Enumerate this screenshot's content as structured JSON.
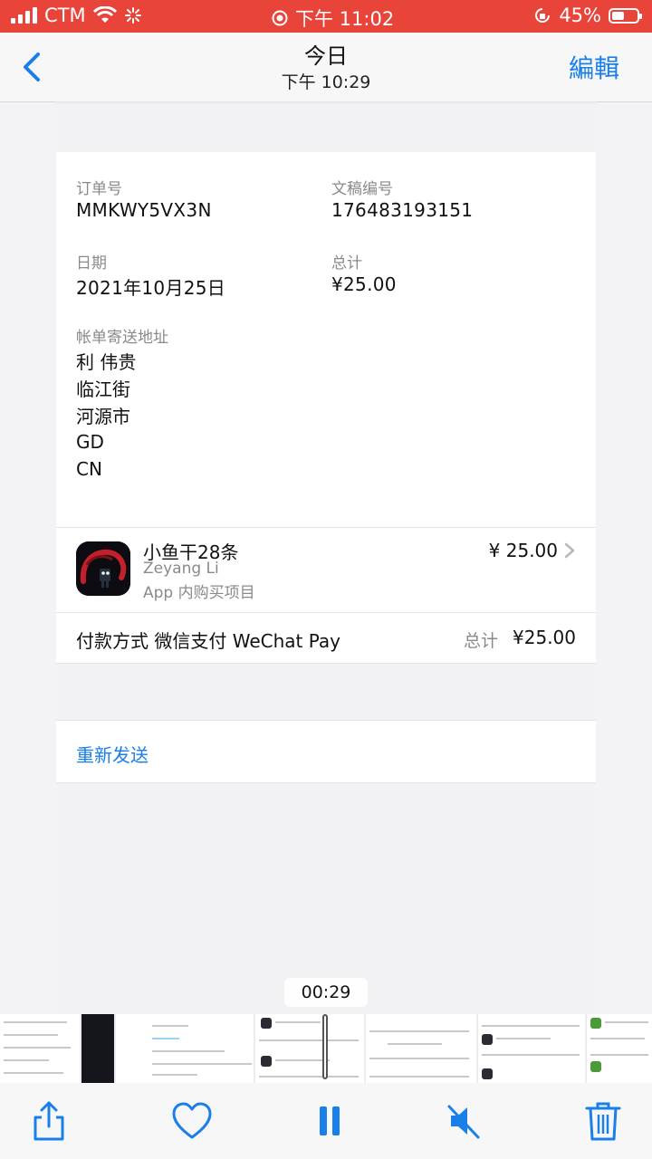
{
  "status_bar": {
    "carrier": "CTM",
    "time": "下午 11:02",
    "battery": "45%"
  },
  "nav": {
    "title": "今日",
    "subtitle": "下午 10:29",
    "edit_label": "編輯"
  },
  "receipt": {
    "order_label": "订单号",
    "order_value": "MMKWY5VX3N",
    "doc_label": "文稿编号",
    "doc_value": "176483193151",
    "date_label": "日期",
    "date_value": "2021年10月25日",
    "total_label": "总计",
    "total_value": "¥25.00",
    "address_label": "帐单寄送地址",
    "address_lines": [
      "利 伟贵",
      "临江街",
      "河源市",
      "GD",
      "CN"
    ],
    "item": {
      "title": "小鱼干28条",
      "developer": "Zeyang Li",
      "type": "App 内购买项目",
      "price": "¥ 25.00"
    },
    "payment_label": "付款方式 微信支付 WeChat Pay",
    "payment_total_label": "总计",
    "payment_total_value": "¥25.00",
    "resend_label": "重新发送"
  },
  "video": {
    "time_badge": "00:29"
  },
  "toolbar": {
    "icons": [
      "share-icon",
      "heart-icon",
      "pause-icon",
      "mute-icon",
      "trash-icon"
    ]
  },
  "colors": {
    "status_bar": "#e8443a",
    "accent": "#1a7fe8"
  }
}
